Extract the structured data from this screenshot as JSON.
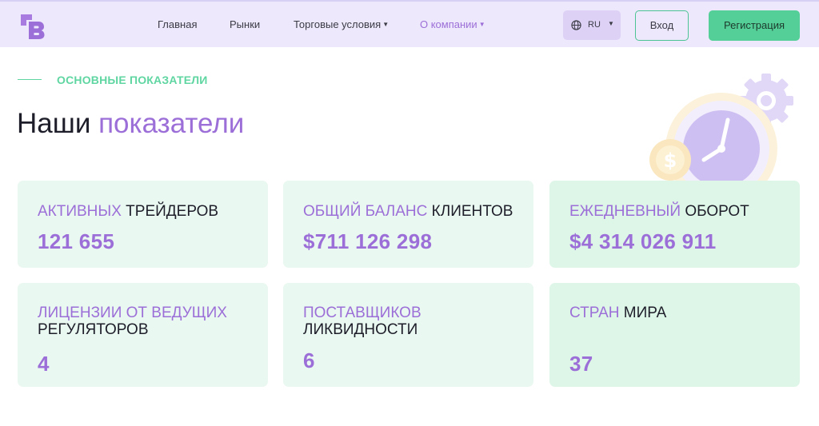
{
  "header": {
    "nav": [
      {
        "label": "Главная",
        "dropdown": false,
        "active": false
      },
      {
        "label": "Рынки",
        "dropdown": false,
        "active": false
      },
      {
        "label": "Торговые условия",
        "dropdown": true,
        "active": false
      },
      {
        "label": "О компании",
        "dropdown": true,
        "active": true
      }
    ],
    "lang": "RU",
    "login_label": "Вход",
    "register_label": "Регистрация"
  },
  "section": {
    "eyebrow": "ОСНОВНЫЕ ПОКАЗАТЕЛИ",
    "title_plain": "Наши",
    "title_accent": "показатели"
  },
  "stats": [
    {
      "highlight": "АКТИВНЫХ",
      "rest": "ТРЕЙДЕРОВ",
      "value": "121 655"
    },
    {
      "highlight": "ОБЩИЙ БАЛАНС",
      "rest": "КЛИЕНТОВ",
      "value": "$711 126 298"
    },
    {
      "highlight": "ЕЖЕДНЕВНЫЙ",
      "rest": "ОБОРОТ",
      "value": "$4 314 026 911"
    },
    {
      "highlight": "ЛИЦЕНЗИИ ОТ ВЕДУЩИХ",
      "rest": "РЕГУЛЯТОРОВ",
      "value": "4"
    },
    {
      "highlight": "ПОСТАВЩИКОВ",
      "rest": "ЛИКВИДНОСТИ",
      "value": "6"
    },
    {
      "highlight": "СТРАН",
      "rest": "МИРА",
      "value": "37"
    }
  ],
  "colors": {
    "accent_purple": "#9c6fd8",
    "accent_green": "#53cf97",
    "header_bg": "#ede8fb",
    "card_bg": "#e9f8f0"
  },
  "icons": {
    "logo": "brand-logo-icon",
    "language": "globe-icon",
    "illustration": "clock-coin-gear-icon"
  }
}
